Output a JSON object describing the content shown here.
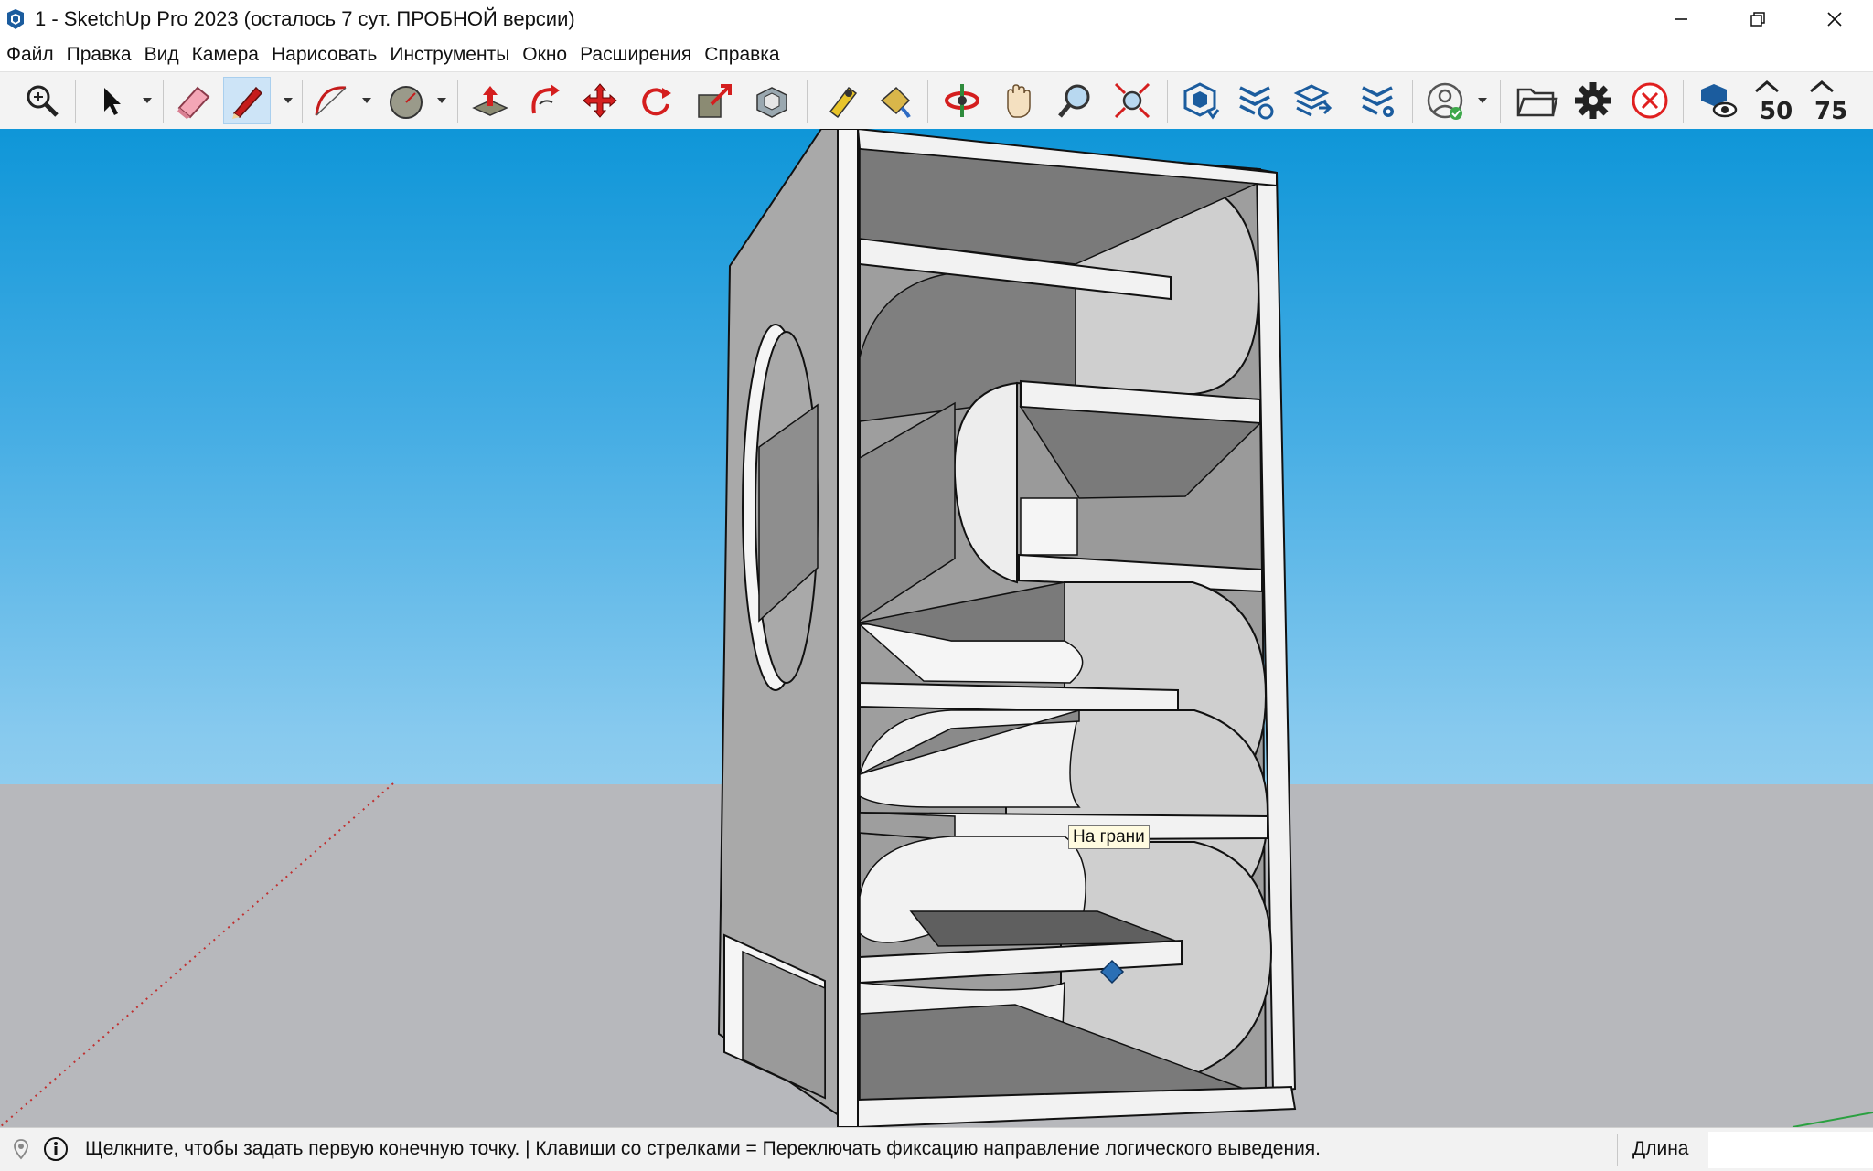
{
  "window": {
    "title": "1 - SketchUp Pro 2023 (осталось 7 сут. ПРОБНОЙ версии)",
    "minimize_icon": "minimize-icon",
    "restore_icon": "restore-icon",
    "close_icon": "close-icon"
  },
  "menu": {
    "items": [
      "Файл",
      "Правка",
      "Вид",
      "Камера",
      "Нарисовать",
      "Инструменты",
      "Окно",
      "Расширения",
      "Справка"
    ]
  },
  "toolbar": {
    "tools": [
      {
        "name": "zoom-extents-icon"
      },
      {
        "name": "select-icon"
      },
      {
        "name": "eraser-icon"
      },
      {
        "name": "line-pencil-icon"
      },
      {
        "name": "arc-icon"
      },
      {
        "name": "circle-shape-icon"
      },
      {
        "name": "push-pull-icon"
      },
      {
        "name": "follow-me-icon"
      },
      {
        "name": "move-icon"
      },
      {
        "name": "rotate-icon"
      },
      {
        "name": "scale-icon"
      },
      {
        "name": "offset-icon"
      },
      {
        "name": "tape-measure-icon"
      },
      {
        "name": "paint-bucket-icon"
      },
      {
        "name": "orbit-icon"
      },
      {
        "name": "pan-icon"
      },
      {
        "name": "zoom-icon"
      },
      {
        "name": "zoom-window-icon"
      },
      {
        "name": "3d-warehouse-icon"
      },
      {
        "name": "extension-warehouse-icon"
      },
      {
        "name": "layout-icon"
      },
      {
        "name": "extension-manager-icon"
      },
      {
        "name": "account-icon"
      },
      {
        "name": "open-folder-icon"
      },
      {
        "name": "settings-gear-icon"
      },
      {
        "name": "cancel-icon"
      },
      {
        "name": "view-eye-icon"
      },
      {
        "name": "zoom-50-icon",
        "label": "50"
      },
      {
        "name": "zoom-75-icon",
        "label": "75"
      }
    ],
    "active_tool": "line-pencil-icon"
  },
  "viewport": {
    "tooltip": "На грани",
    "sky_color": "#0f96d8",
    "ground_color": "#b7b8bc"
  },
  "status": {
    "message": "Щелкните, чтобы задать первую конечную точку. | Клавиши со стрелками = Переключать фиксацию направление логического выведения.",
    "vcb_label": "Длина",
    "vcb_value": ""
  }
}
